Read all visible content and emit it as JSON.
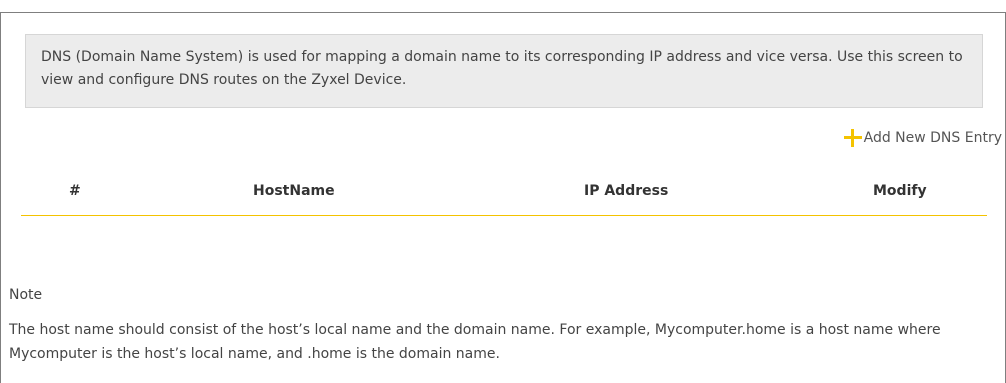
{
  "description": "DNS (Domain Name System) is used for mapping a domain name to its corresponding IP address and vice versa. Use this screen to view and configure DNS routes on the Zyxel Device.",
  "toolbar": {
    "add_label": "Add New DNS Entry",
    "add_icon": "plus-icon"
  },
  "table": {
    "columns": {
      "num": "#",
      "hostname": "HostName",
      "ip": "IP Address",
      "modify": "Modify"
    },
    "rows": []
  },
  "note": {
    "title": "Note",
    "text": "The host name should consist of the host’s local name and the domain name. For example, Mycomputer.home is a host name where Mycomputer is the host’s local name, and .home is the domain name."
  },
  "colors": {
    "accent": "#f4c300",
    "panel_bg": "#ececec",
    "text": "#444444"
  }
}
